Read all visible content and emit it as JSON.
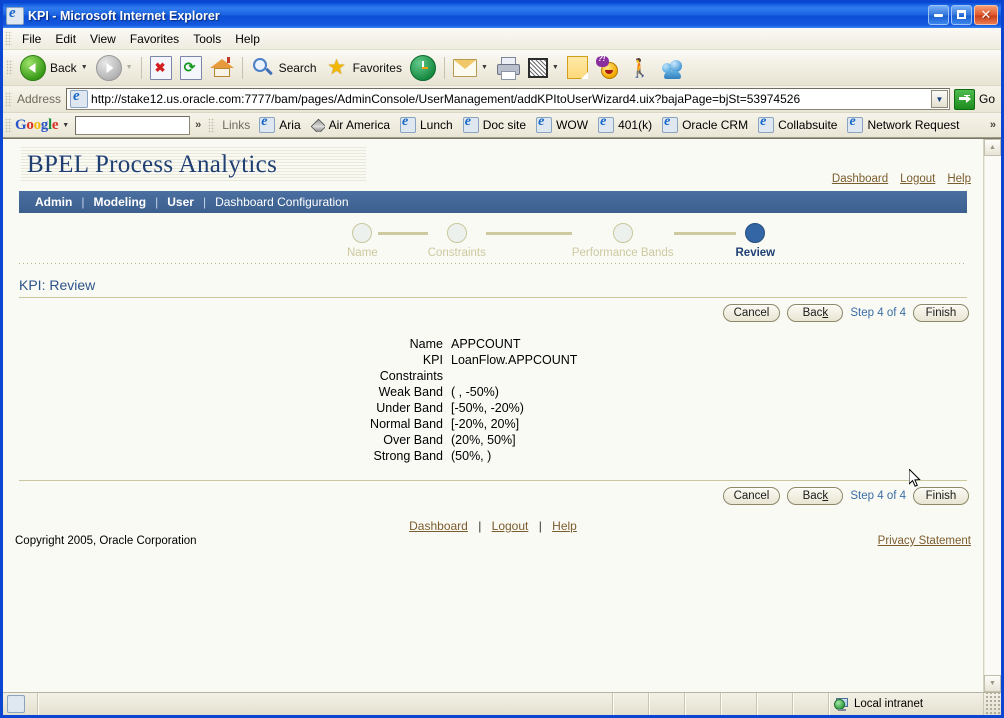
{
  "window": {
    "title": "KPI - Microsoft Internet Explorer",
    "icon": "ie-document-icon",
    "minimize_label": "Minimize",
    "maximize_label": "Maximize",
    "close_label": "✕"
  },
  "menubar": {
    "items": [
      "File",
      "Edit",
      "View",
      "Favorites",
      "Tools",
      "Help"
    ]
  },
  "toolbar": {
    "back_label": "Back",
    "search_label": "Search",
    "favorites_label": "Favorites",
    "overflow": "»"
  },
  "address": {
    "label": "Address",
    "url": "http://stake12.us.oracle.com:7777/bam/pages/AdminConsole/UserManagement/addKPItoUserWizard4.uix?bajaPage=bjSt=53974526",
    "go_label": "Go",
    "dropdown_glyph": "▼"
  },
  "links_bar": {
    "google_label": "Google",
    "google_parts": [
      "G",
      "o",
      "o",
      "g",
      "l",
      "e"
    ],
    "search_value": "",
    "overflow_left": "»",
    "links_label": "Links",
    "links": [
      "Aria",
      "Air America",
      "Lunch",
      "Doc site",
      "WOW",
      "401(k)",
      "Oracle CRM",
      "Collabsuite",
      "Network Request"
    ],
    "overflow_right": "»"
  },
  "branding": {
    "title": "BPEL Process Analytics",
    "header_links": [
      "Dashboard",
      "Logout",
      "Help"
    ]
  },
  "navbar": {
    "items": [
      {
        "label": "Admin",
        "bold": true
      },
      {
        "label": "Modeling",
        "bold": true
      },
      {
        "label": "User",
        "bold": true
      },
      {
        "label": "Dashboard Configuration",
        "bold": false
      }
    ],
    "separator": "|"
  },
  "wizard": {
    "steps": [
      {
        "label": "Name",
        "active": false
      },
      {
        "label": "Constraints",
        "active": false
      },
      {
        "label": "Performance Bands",
        "active": false
      },
      {
        "label": "Review",
        "active": true
      }
    ]
  },
  "page": {
    "heading": "KPI: Review",
    "buttons": {
      "cancel": "Cancel",
      "back_prefix": "Bac",
      "back_accel": "k",
      "step_text": "Step 4 of 4",
      "finish": "Finish"
    },
    "review_rows": [
      {
        "label": "Name",
        "value": "APPCOUNT"
      },
      {
        "label": "KPI",
        "value": "LoanFlow.APPCOUNT"
      },
      {
        "label": "Constraints",
        "value": ""
      },
      {
        "label": "Weak Band",
        "value": "( , -50%)"
      },
      {
        "label": "Under Band",
        "value": "[-50%, -20%)"
      },
      {
        "label": "Normal Band",
        "value": "[-20%, 20%]"
      },
      {
        "label": "Over Band",
        "value": "(20%, 50%]"
      },
      {
        "label": "Strong Band",
        "value": "(50%, )"
      }
    ]
  },
  "footer": {
    "links": [
      "Dashboard",
      "Logout",
      "Help"
    ],
    "separator": "|",
    "copyright": "Copyright 2005, Oracle Corporation",
    "privacy": "Privacy Statement"
  },
  "statusbar": {
    "zone": "Local intranet",
    "zone_icon": "local-intranet-icon"
  },
  "colors": {
    "title_blue": "#0a46d2",
    "nav_blue": "#3c5f8e",
    "brand_navy": "#1f3f73",
    "accent_khaki": "#c9c79b",
    "link_brown": "#7b5c2e",
    "step_blue": "#3a6ea5"
  }
}
